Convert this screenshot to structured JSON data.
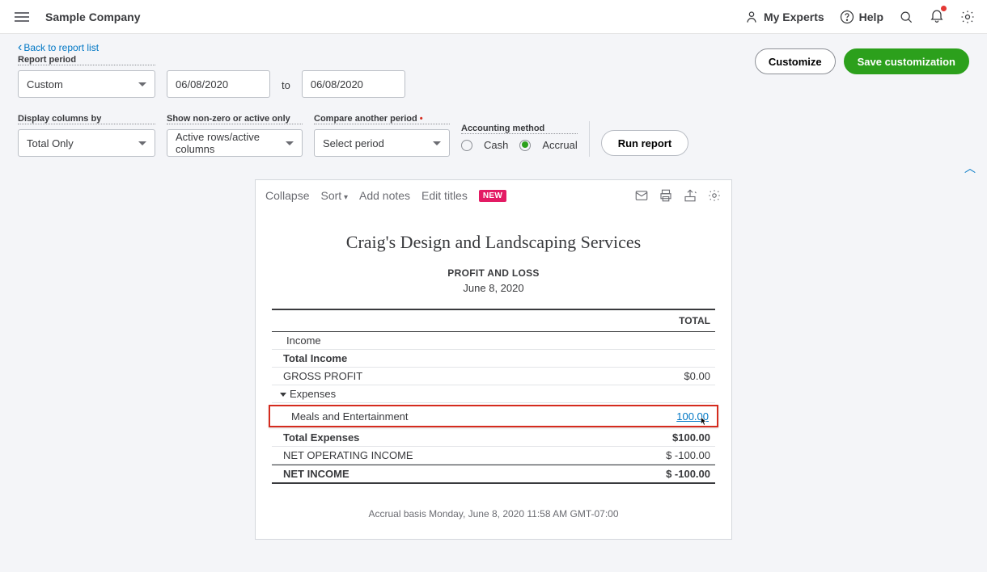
{
  "header": {
    "company": "Sample Company",
    "myExperts": "My Experts",
    "help": "Help"
  },
  "topButtons": {
    "customize": "Customize",
    "save": "Save customization"
  },
  "backLink": "Back to report list",
  "labels": {
    "reportPeriod": "Report period",
    "to": "to",
    "displayCols": "Display columns by",
    "showNonZero": "Show non-zero or active only",
    "comparePeriod": "Compare another period",
    "accountingMethod": "Accounting method"
  },
  "filters": {
    "periodType": "Custom",
    "dateFrom": "06/08/2020",
    "dateTo": "06/08/2020",
    "displayColumns": "Total Only",
    "showNonZero": "Active rows/active columns",
    "comparePeriod": "Select period",
    "radioCash": "Cash",
    "radioAccrual": "Accrual",
    "runReport": "Run report"
  },
  "reportToolbar": {
    "collapse": "Collapse",
    "sort": "Sort",
    "addNotes": "Add notes",
    "editTitles": "Edit titles",
    "newBadge": "NEW"
  },
  "report": {
    "companyName": "Craig's Design and Landscaping Services",
    "reportType": "PROFIT AND LOSS",
    "period": "June 8, 2020",
    "colHeader": "TOTAL",
    "rows": {
      "income": "Income",
      "totalIncome": "Total Income",
      "grossProfit": "GROSS PROFIT",
      "grossProfitVal": "$0.00",
      "expenses": "Expenses",
      "meals": "Meals and Entertainment",
      "mealsVal": "100.00",
      "totalExpenses": "Total Expenses",
      "totalExpensesVal": "$100.00",
      "netOpIncome": "NET OPERATING INCOME",
      "netOpIncomeVal": "$ -100.00",
      "netIncome": "NET INCOME",
      "netIncomeVal": "$ -100.00"
    },
    "footer": "Accrual basis   Monday, June 8, 2020   11:58 AM GMT-07:00"
  }
}
